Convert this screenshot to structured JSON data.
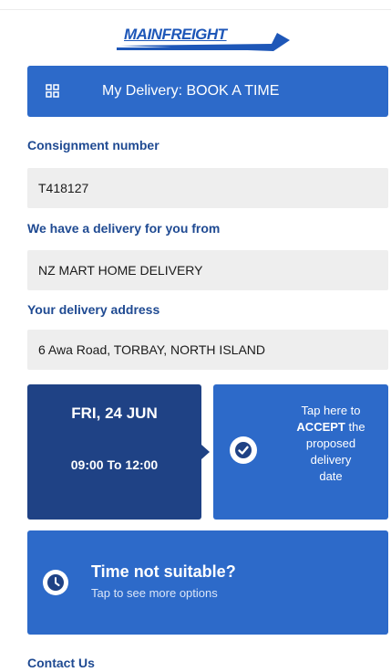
{
  "header": {
    "logo_text": "MAINFREIGHT",
    "banner_title": "My Delivery: BOOK A TIME",
    "banner_icon": "grid-icon"
  },
  "fields": {
    "consignment_label": "Consignment number",
    "consignment_value": "T418127",
    "sender_label": "We have a delivery for you from",
    "sender_value": "NZ MART HOME DELIVERY",
    "address_label": "Your delivery address",
    "address_value": "6 Awa Road, TORBAY, NORTH ISLAND"
  },
  "delivery": {
    "date": "FRI, 24 JUN",
    "time": "09:00 To 12:00",
    "accept_prefix": "Tap here to",
    "accept_strong": "ACCEPT",
    "accept_suffix1": "the",
    "accept_suffix2": "proposed",
    "accept_suffix3": "delivery",
    "accept_suffix4": "date",
    "check_icon": "check-circle-icon"
  },
  "alternative": {
    "heading": "Time not suitable?",
    "subtext": "Tap to see more options",
    "icon": "clock-icon"
  },
  "footer": {
    "contact": "Contact Us"
  },
  "colors": {
    "primary": "#2d6ac9",
    "dark": "#1f4285",
    "label": "#1f4a92",
    "field_bg": "#eeeeee"
  }
}
